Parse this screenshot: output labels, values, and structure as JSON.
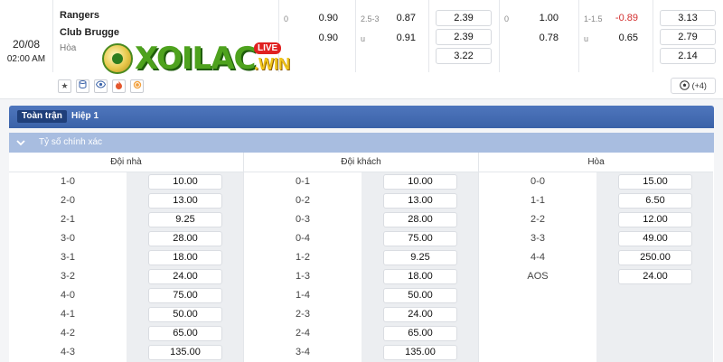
{
  "match": {
    "date": "20/08",
    "time": "02:00 AM",
    "home": "Rangers",
    "away": "Club Brugge",
    "draw": "Hòa"
  },
  "logo": {
    "word": "XOILAC",
    "live": "LIVE",
    "win": ".WIN"
  },
  "odds": {
    "ft_hdp": {
      "home_line": "0",
      "home": "0.90",
      "away": "0.90"
    },
    "ft_ou": {
      "line": "2.5-3",
      "over": "0.87",
      "under_label": "u",
      "under": "0.91"
    },
    "ft_1x2": [
      "2.39",
      "2.39",
      "3.22"
    ],
    "h1_hdp": {
      "home_line": "0",
      "home": "1.00",
      "away": "0.78"
    },
    "h1_ou": {
      "line": "1-1.5",
      "over": "-0.89",
      "under_label": "u",
      "under": "0.65"
    },
    "h1_1x2": [
      "3.13",
      "2.79",
      "2.14"
    ]
  },
  "more_markets": "(+4)",
  "tabs": [
    "Toàn trận",
    "Hiệp 1"
  ],
  "section_title": "Tỷ số chính xác",
  "columns": [
    {
      "header": "Đội nhà",
      "rows": [
        {
          "score": "1-0",
          "odd": "10.00"
        },
        {
          "score": "2-0",
          "odd": "13.00"
        },
        {
          "score": "2-1",
          "odd": "9.25"
        },
        {
          "score": "3-0",
          "odd": "28.00"
        },
        {
          "score": "3-1",
          "odd": "18.00"
        },
        {
          "score": "3-2",
          "odd": "24.00"
        },
        {
          "score": "4-0",
          "odd": "75.00"
        },
        {
          "score": "4-1",
          "odd": "50.00"
        },
        {
          "score": "4-2",
          "odd": "65.00"
        },
        {
          "score": "4-3",
          "odd": "135.00"
        }
      ]
    },
    {
      "header": "Đội khách",
      "rows": [
        {
          "score": "0-1",
          "odd": "10.00"
        },
        {
          "score": "0-2",
          "odd": "13.00"
        },
        {
          "score": "0-3",
          "odd": "28.00"
        },
        {
          "score": "0-4",
          "odd": "75.00"
        },
        {
          "score": "1-2",
          "odd": "9.25"
        },
        {
          "score": "1-3",
          "odd": "18.00"
        },
        {
          "score": "1-4",
          "odd": "50.00"
        },
        {
          "score": "2-3",
          "odd": "24.00"
        },
        {
          "score": "2-4",
          "odd": "65.00"
        },
        {
          "score": "3-4",
          "odd": "135.00"
        }
      ]
    },
    {
      "header": "Hòa",
      "rows": [
        {
          "score": "0-0",
          "odd": "15.00"
        },
        {
          "score": "1-1",
          "odd": "6.50"
        },
        {
          "score": "2-2",
          "odd": "12.00"
        },
        {
          "score": "3-3",
          "odd": "49.00"
        },
        {
          "score": "4-4",
          "odd": "250.00"
        },
        {
          "score": "AOS",
          "odd": "24.00"
        }
      ]
    }
  ],
  "icons": [
    "star-icon",
    "stats-icon",
    "eye-icon",
    "fire-icon",
    "coin-icon",
    "ball-icon"
  ]
}
